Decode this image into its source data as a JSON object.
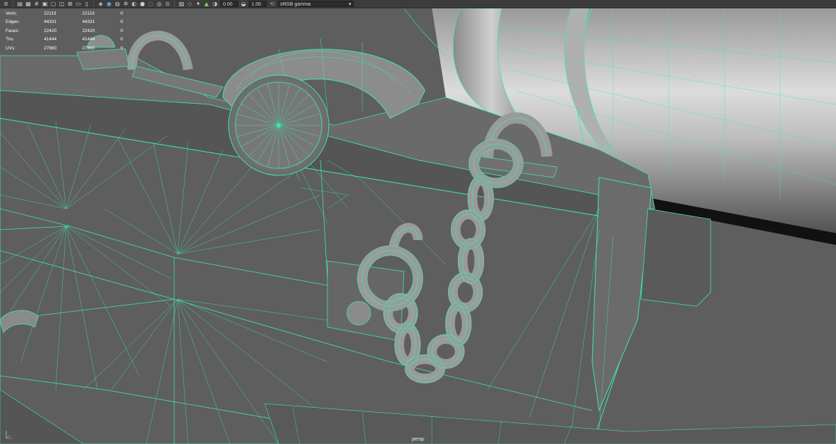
{
  "toolbar": {
    "icons": [
      "camera-icon",
      "bookmark-icon",
      "image-plane-icon",
      "grid-icon",
      "film-gate-icon",
      "resolution-gate-icon",
      "gate-mask-icon",
      "field-chart-icon",
      "safe-action-icon",
      "safe-title-icon",
      "wireframe-icon",
      "smooth-shade-icon",
      "textured-icon",
      "lights-icon",
      "shadows-icon",
      "ambient-occlusion-icon",
      "motion-blur-icon",
      "anti-alias-icon",
      "depth-of-field-icon",
      "isolate-icon",
      "xray-icon",
      "xray-joints-icon",
      "backface-icon",
      "exposure-icon"
    ],
    "exposure_value": "0.00",
    "gamma_value": "1.00",
    "color_space": "sRGB gamma"
  },
  "hud": {
    "rows": [
      {
        "label": "Verts:",
        "a": "22113",
        "b": "22113",
        "c": "0"
      },
      {
        "label": "Edges:",
        "a": "44331",
        "b": "44331",
        "c": "0"
      },
      {
        "label": "Faces:",
        "a": "22420",
        "b": "22420",
        "c": "0"
      },
      {
        "label": "Tris:",
        "a": "41444",
        "b": "41444",
        "c": "0"
      },
      {
        "label": "UVs:",
        "a": "27860",
        "b": "27860",
        "c": "0"
      }
    ]
  },
  "viewport": {
    "camera": "persp",
    "wire_color": "#3ee8a8",
    "bg_color": "#5f5f5f"
  }
}
